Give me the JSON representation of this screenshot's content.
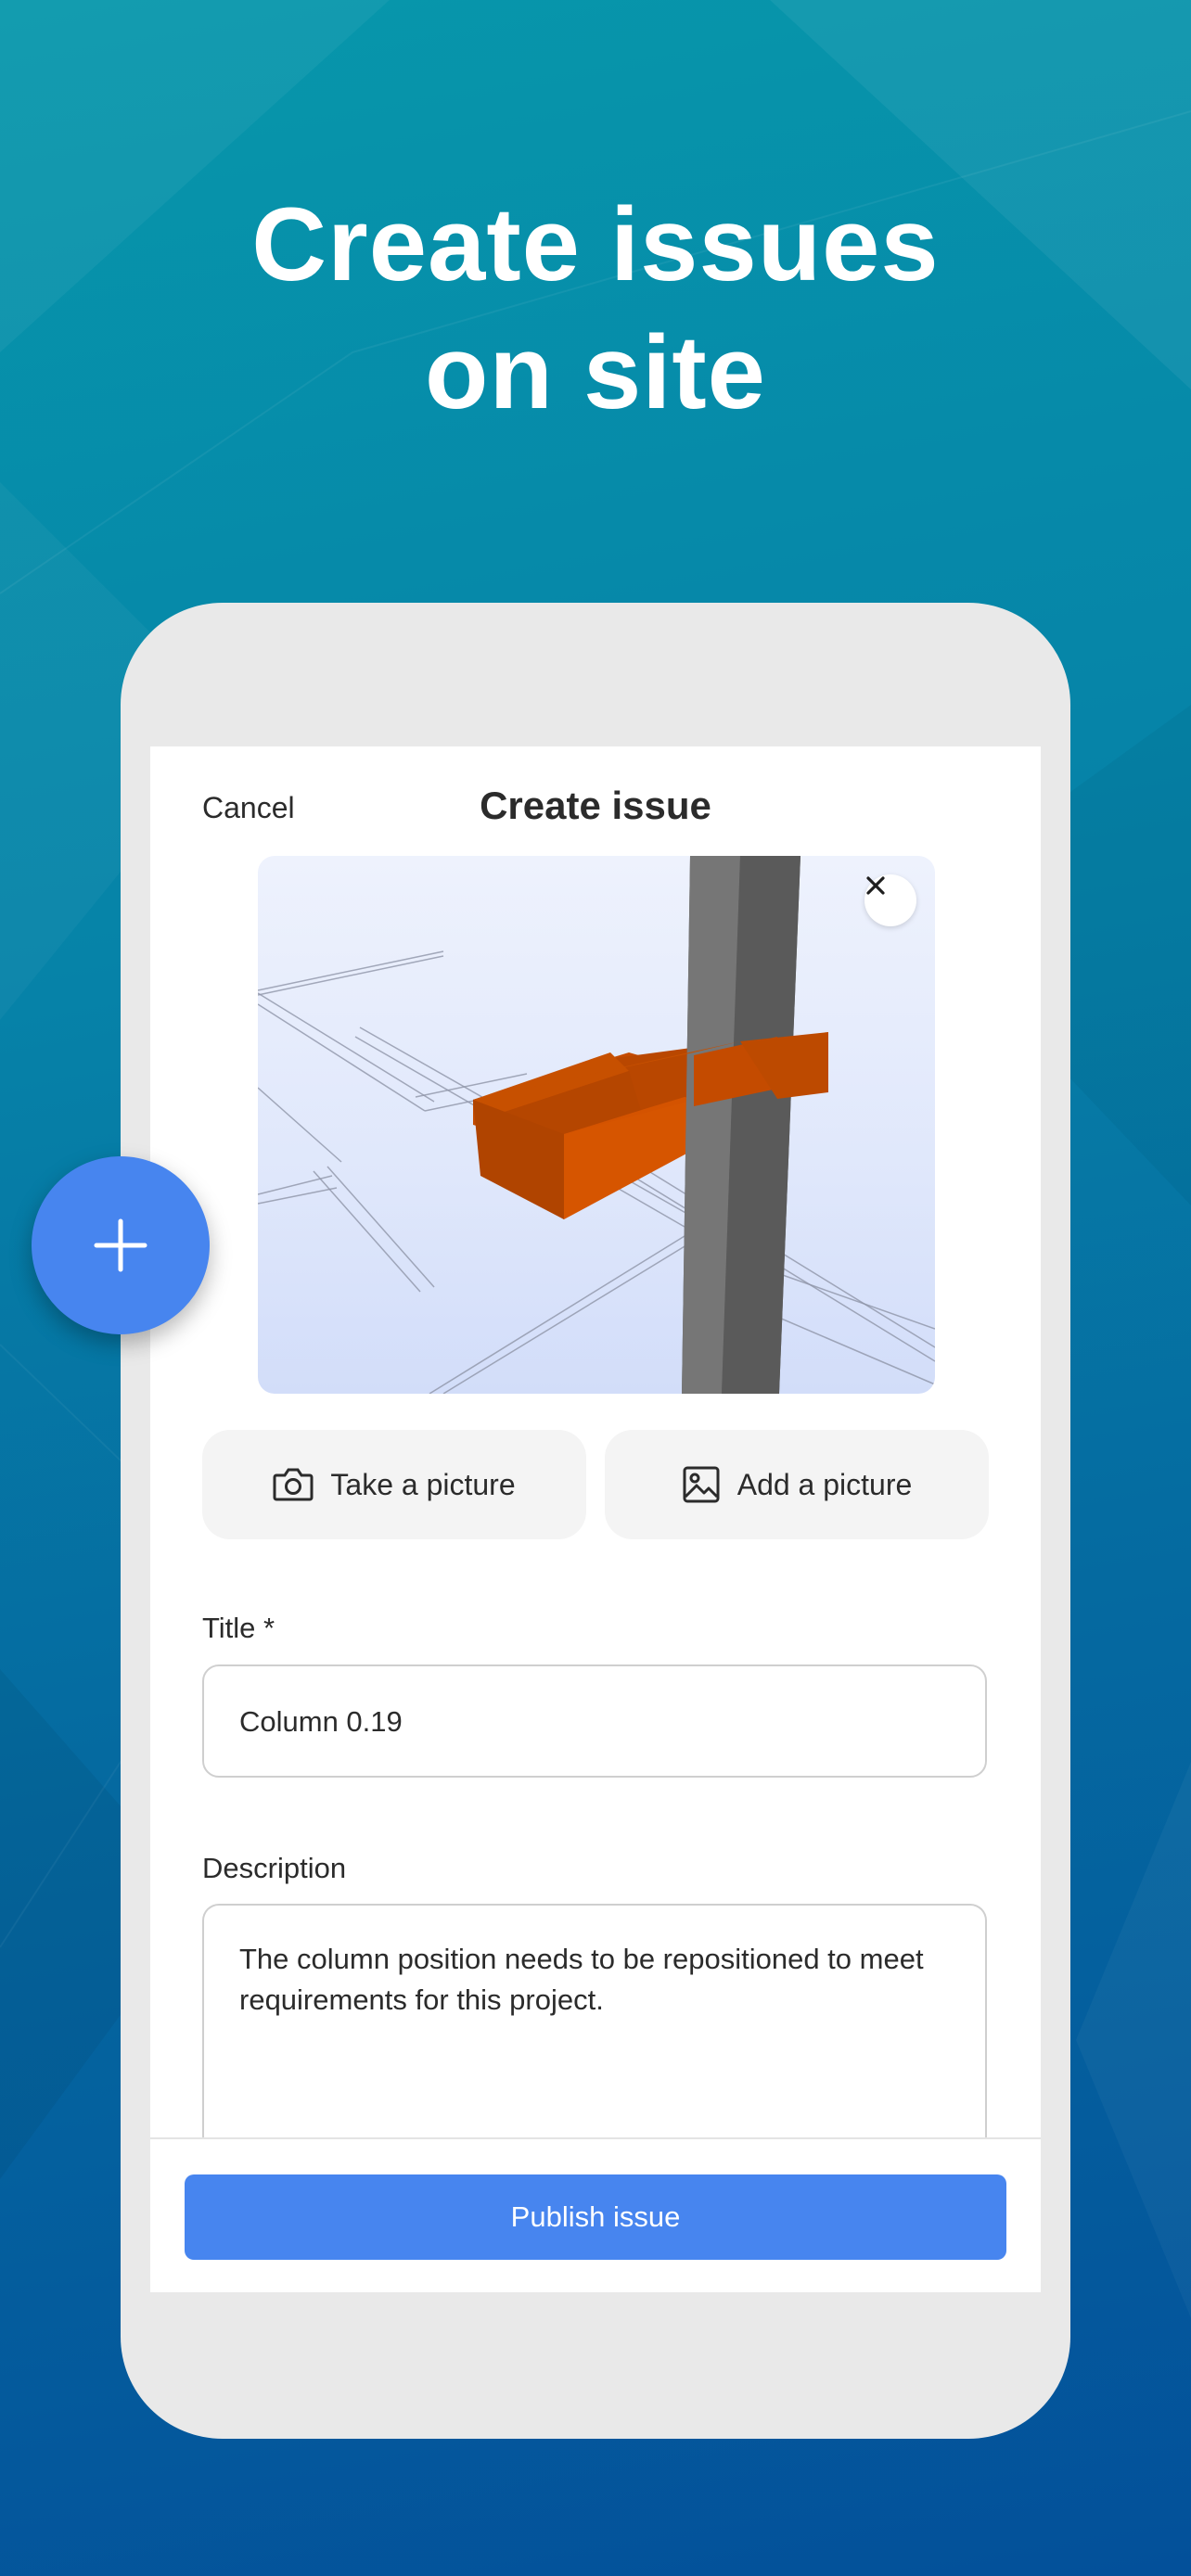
{
  "headline": {
    "line1": "Create issues",
    "line2": "on site"
  },
  "nav": {
    "cancel_label": "Cancel",
    "title": "Create issue"
  },
  "preview": {
    "close_icon": "close-icon"
  },
  "photo_actions": {
    "take_label": "Take a picture",
    "take_icon": "camera-icon",
    "add_label": "Add a picture",
    "add_icon": "image-icon"
  },
  "form": {
    "title_label": "Title *",
    "title_value": "Column 0.19",
    "description_label": "Description",
    "description_value": "The column position needs to be repositioned to meet requirements for this project."
  },
  "footer": {
    "publish_label": "Publish issue"
  },
  "fab": {
    "icon": "plus-icon"
  },
  "colors": {
    "accent": "#4785ef",
    "beam": "#d45300",
    "column": "#6e6e6e"
  }
}
